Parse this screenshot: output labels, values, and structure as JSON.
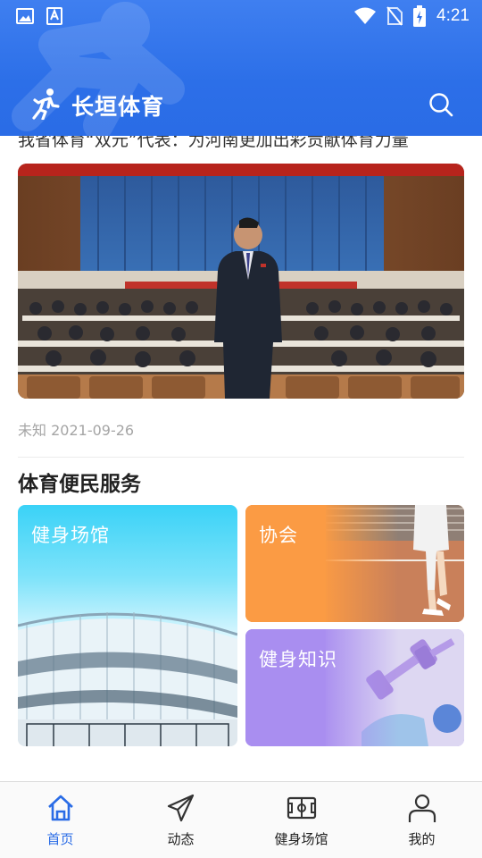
{
  "status_bar": {
    "time": "4:21",
    "icons": [
      "image-icon",
      "font-a-icon",
      "wifi-icon",
      "no-sim-icon",
      "battery-charging-icon"
    ]
  },
  "app_bar": {
    "title": "长垣体育",
    "logo_icon": "runner-icon",
    "search_icon": "search-icon"
  },
  "article": {
    "title": "我省体育“双元”代表：为河南更加出彩贡献体育力量",
    "photo": "conference-hall-photo",
    "source": "未知",
    "date": "2021-09-26"
  },
  "services": {
    "title": "体育便民服务",
    "cards": [
      {
        "label": "健身场馆",
        "color": "#3ad2f7"
      },
      {
        "label": "协会",
        "color": "#fb9b44"
      },
      {
        "label": "健身知识",
        "color": "#a98ef0"
      }
    ]
  },
  "bottom_nav": {
    "active_color": "#2a6ce6",
    "items": [
      {
        "label": "首页",
        "icon": "home-icon",
        "active": true
      },
      {
        "label": "动态",
        "icon": "paper-plane-icon",
        "active": false
      },
      {
        "label": "健身场馆",
        "icon": "stadium-icon",
        "active": false
      },
      {
        "label": "我的",
        "icon": "person-icon",
        "active": false
      }
    ]
  }
}
